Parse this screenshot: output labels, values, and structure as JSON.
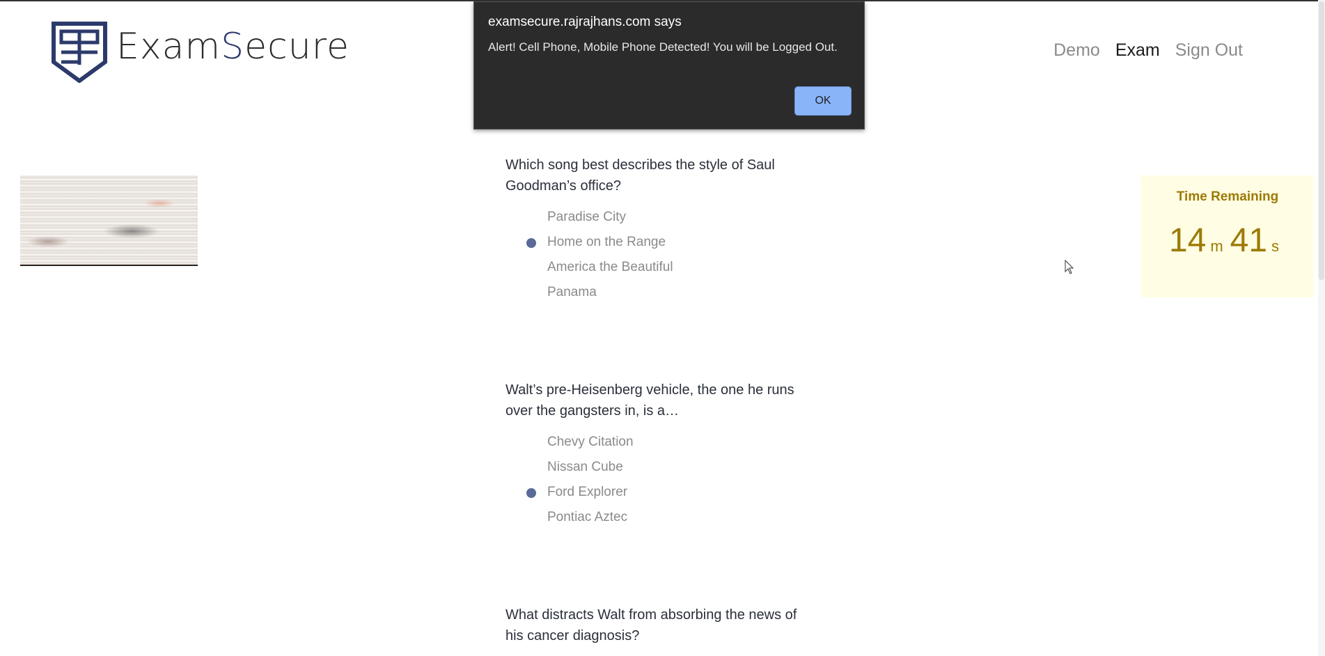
{
  "header": {
    "brand_prefix": "Exam",
    "brand_letter": "S",
    "brand_suffix": "ecure",
    "logo_icon": "shield-es-logo-icon",
    "nav": [
      {
        "label": "Demo",
        "active": false
      },
      {
        "label": "Exam",
        "active": true
      },
      {
        "label": "Sign Out",
        "active": false
      }
    ]
  },
  "questions": [
    {
      "text": "Which song best describes the style of Saul Goodman’s office?",
      "options": [
        {
          "label": "Paradise City",
          "selected": false
        },
        {
          "label": "Home on the Range",
          "selected": true
        },
        {
          "label": "America the Beautiful",
          "selected": false
        },
        {
          "label": "Panama",
          "selected": false
        }
      ]
    },
    {
      "text": "Walt’s pre-Heisenberg vehicle, the one he runs over the gangsters in, is a…",
      "options": [
        {
          "label": "Chevy Citation",
          "selected": false
        },
        {
          "label": "Nissan Cube",
          "selected": false
        },
        {
          "label": "Ford Explorer",
          "selected": true
        },
        {
          "label": "Pontiac Aztec",
          "selected": false
        }
      ]
    },
    {
      "text": "What distracts Walt from absorbing the news of his cancer diagnosis?",
      "options": []
    }
  ],
  "timer": {
    "label": "Time Remaining",
    "minutes": "14",
    "minutes_unit": "m",
    "seconds": "41",
    "seconds_unit": "s"
  },
  "dialog": {
    "title": "examsecure.rajrajhans.com says",
    "message": "Alert! Cell Phone, Mobile Phone Detected! You will be Logged Out.",
    "ok_label": "OK"
  },
  "colors": {
    "brand_navy": "#2c3a6b",
    "radio_selected": "#5a6a99",
    "timer_bg": "#fffde3",
    "timer_text": "#9c7a05",
    "dialog_bg": "#2b2b2b",
    "ok_button": "#8ab4f8"
  }
}
